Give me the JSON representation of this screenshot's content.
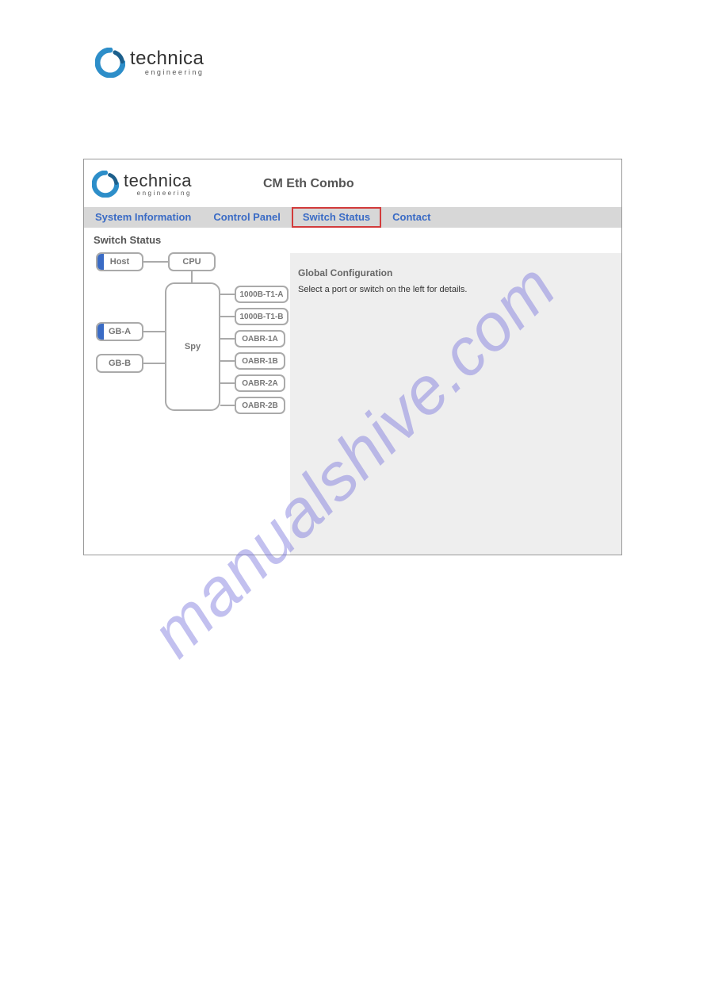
{
  "page_logo": {
    "brand": "technica",
    "tagline": "engineering"
  },
  "app": {
    "logo": {
      "brand": "technica",
      "tagline": "engineering"
    },
    "title": "CM Eth Combo",
    "tabs": [
      {
        "label": "System Information",
        "active": false
      },
      {
        "label": "Control Panel",
        "active": false
      },
      {
        "label": "Switch Status",
        "active": true
      },
      {
        "label": "Contact",
        "active": false
      }
    ],
    "left": {
      "title": "Switch Status",
      "nodes": {
        "host": "Host",
        "cpu": "CPU",
        "spy": "Spy",
        "gba": "GB-A",
        "gbb": "GB-B",
        "pt1a": "1000B-T1-A",
        "pt1b": "1000B-T1-B",
        "po1a": "OABR-1A",
        "po1b": "OABR-1B",
        "po2a": "OABR-2A",
        "po2b": "OABR-2B"
      }
    },
    "right": {
      "title": "Global Configuration",
      "message": "Select a port or switch on the left for details."
    }
  },
  "watermark": "manualshive.com"
}
